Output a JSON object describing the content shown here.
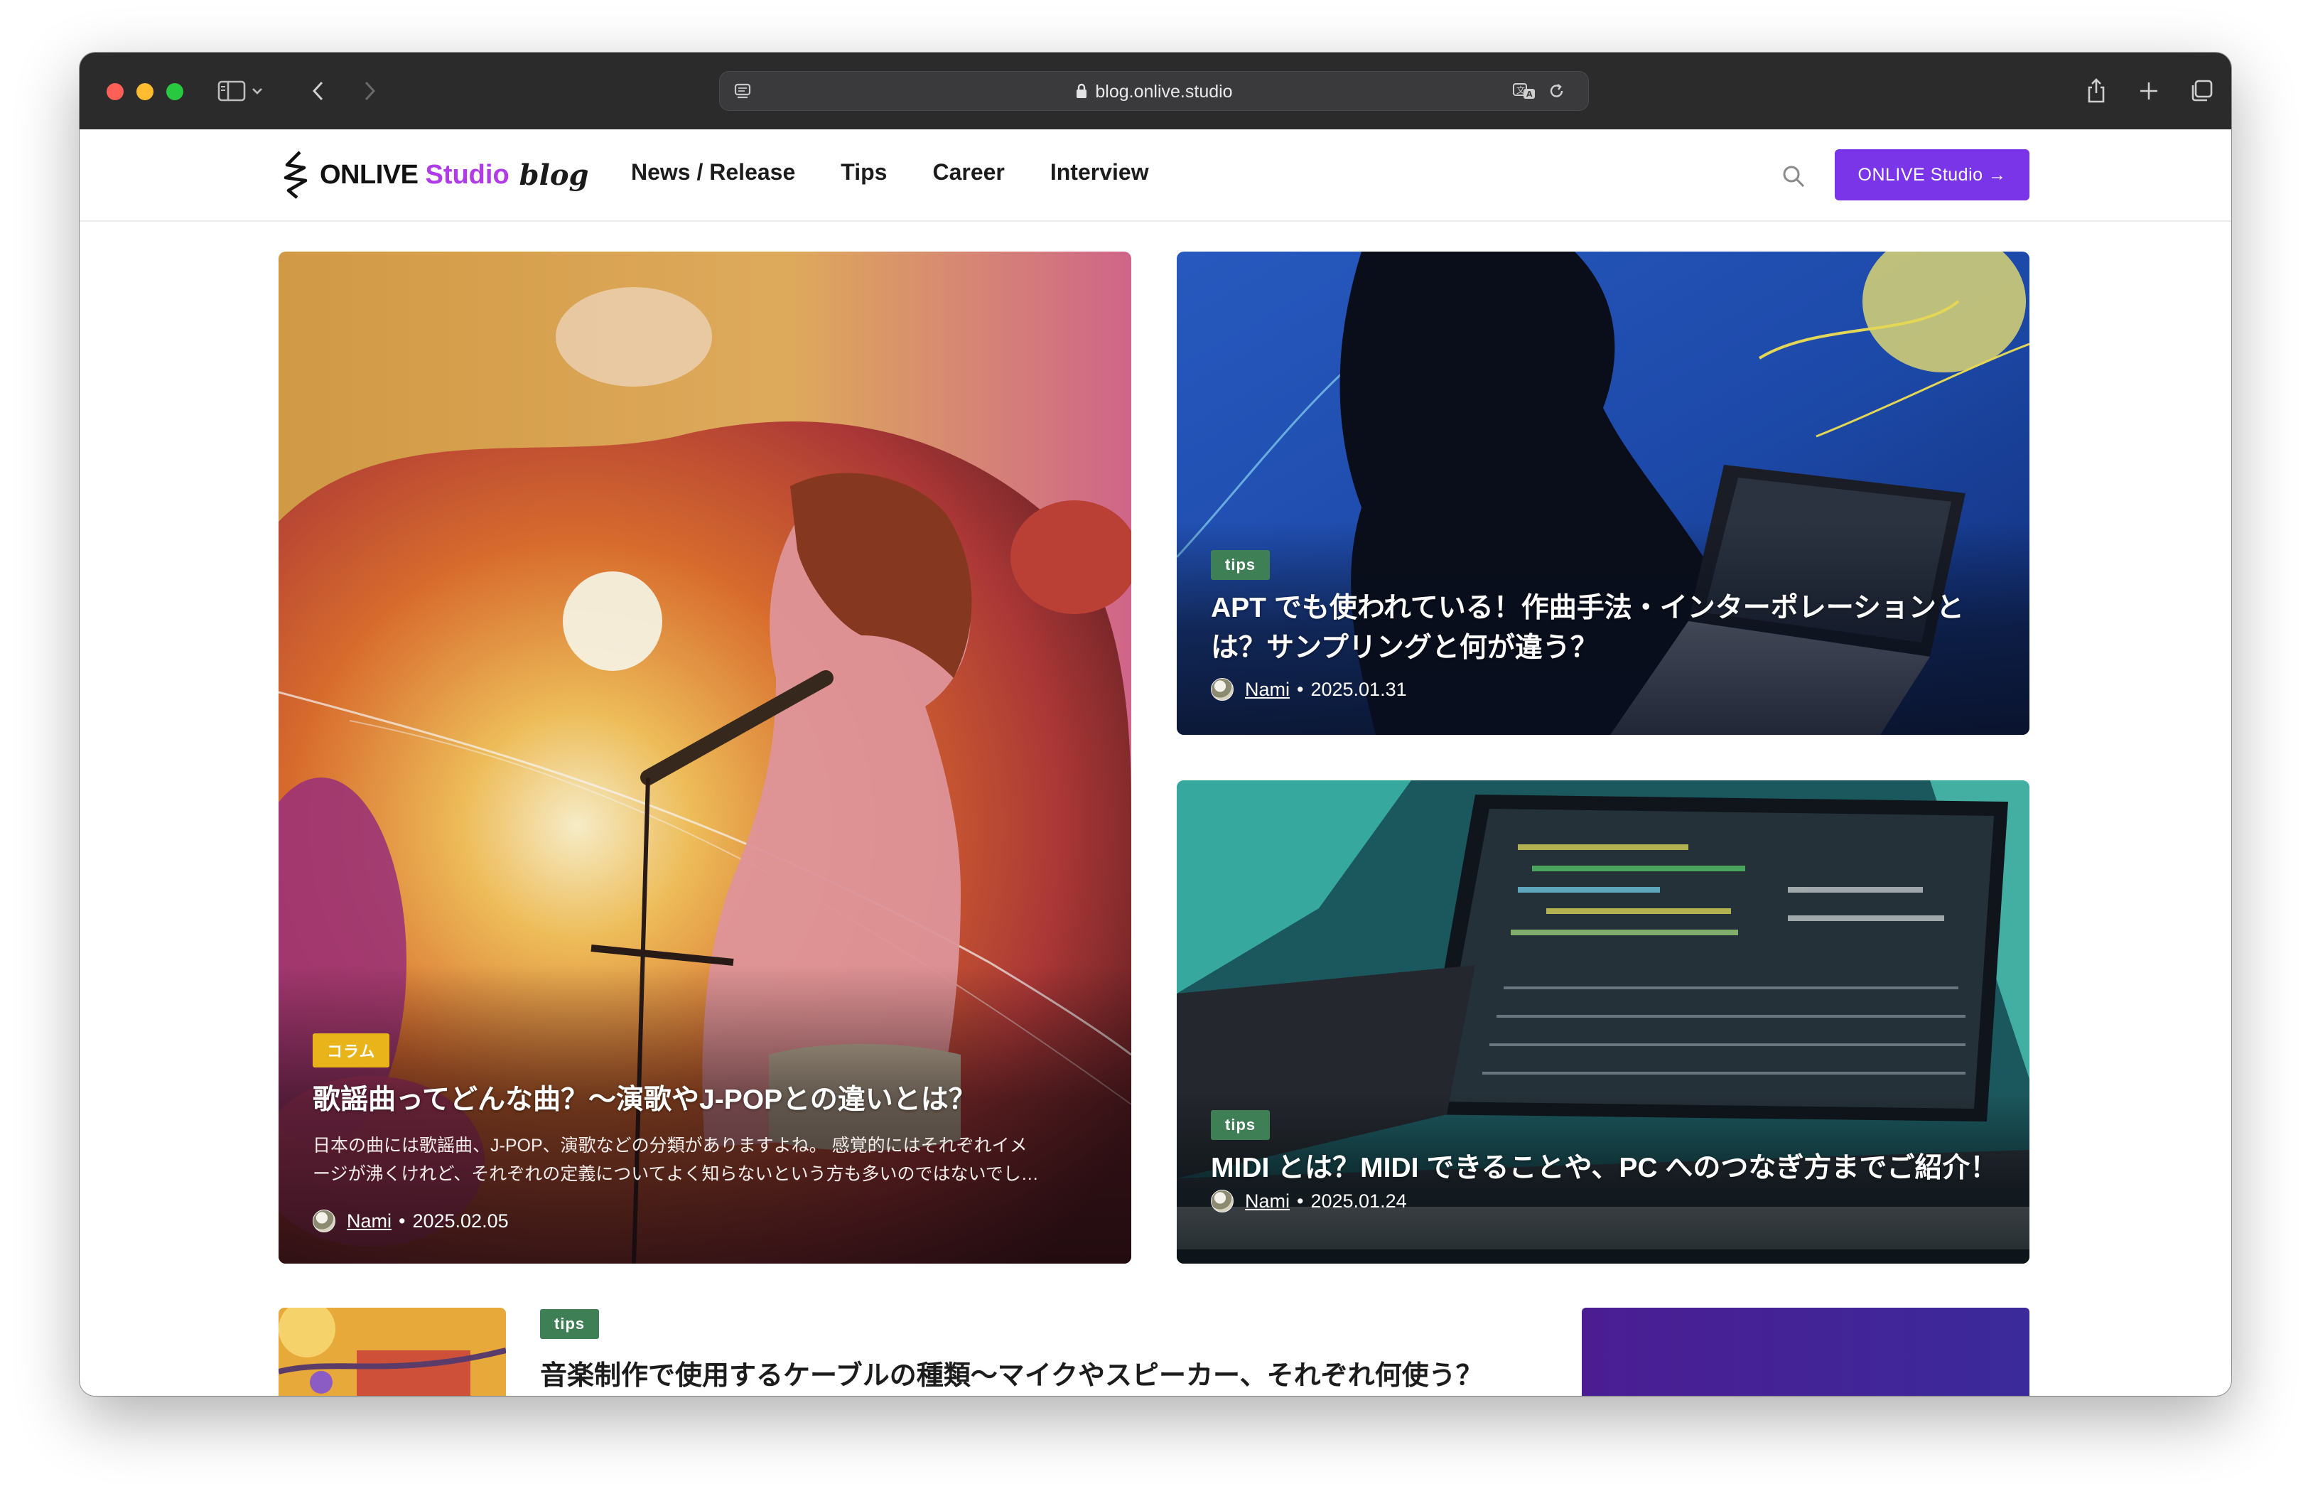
{
  "browser": {
    "url": "blog.onlive.studio"
  },
  "header": {
    "logo": {
      "brand": "ONLIVE",
      "studio": "Studio",
      "blog": "blog"
    },
    "nav": [
      "News / Release",
      "Tips",
      "Career",
      "Interview"
    ],
    "cta_label": "ONLIVE Studio →"
  },
  "featured": [
    {
      "tag": "コラム",
      "title": "歌謡曲ってどんな曲？～演歌やJ-POPとの違いとは？",
      "excerpt_line1": "日本の曲には歌謡曲、J-POP、演歌などの分類がありますよね。 感覚的にはそれぞれイメ",
      "excerpt_line2": "ージが沸くけれど、それぞれの定義についてよく知らないという方も多いのではないでし…",
      "author": "Nami",
      "date": "2025.02.05"
    },
    {
      "tag": "tips",
      "title_line1": "APT でも使われている！作曲手法・インターポレーションと",
      "title_line2": "は？サンプリングと何が違う？",
      "author": "Nami",
      "date": "2025.01.31"
    },
    {
      "tag": "tips",
      "title": "MIDI とは？MIDI できることや、PC へのつなぎ方までご紹介！",
      "author": "Nami",
      "date": "2025.01.24"
    }
  ],
  "list": [
    {
      "tag": "tips",
      "title": "音楽制作で使用するケーブルの種類～マイクやスピーカー、それぞれ何使う？"
    }
  ],
  "colors": {
    "accent": "#7a35e8",
    "studio_text": "#b03be9",
    "tag_tips": "#3f7f55",
    "tag_column": "#e8b41a"
  }
}
